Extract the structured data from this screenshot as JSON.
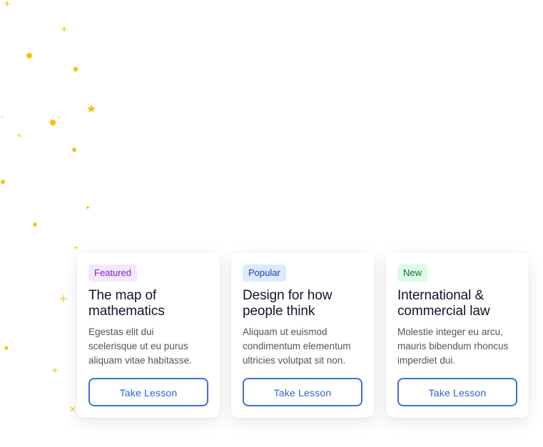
{
  "colors": {
    "accent": "#2f63cf",
    "decor": "#f5c400",
    "featured_bg": "#f3e8ff",
    "featured_text": "#7e22ce",
    "popular_bg": "#dbeafe",
    "popular_text": "#1e40af",
    "new_bg": "#dcfce7",
    "new_text": "#166534"
  },
  "cards": [
    {
      "badge": "Featured",
      "title_line1": "The map of",
      "title_line2": "mathematics",
      "desc_line1": "Egestas elit dui",
      "desc_line2": "scelerisque ut eu purus",
      "desc_line3": "aliquam vitae habitasse.",
      "button": "Take Lesson"
    },
    {
      "badge": "Popular",
      "title_line1": "Design for how",
      "title_line2": "people think",
      "desc_line1": "Aliquam ut euismod",
      "desc_line2": "condimentum elementum",
      "desc_line3": "ultricies volutpat sit non.",
      "button": "Take Lesson"
    },
    {
      "badge": "New",
      "title_line1": "International &",
      "title_line2": "commercial law",
      "desc_line1": "Molestie integer eu arcu,",
      "desc_line2": "mauris bibendum rhoncus",
      "desc_line3": "imperdiet dui.",
      "button": "Take Lesson"
    }
  ]
}
